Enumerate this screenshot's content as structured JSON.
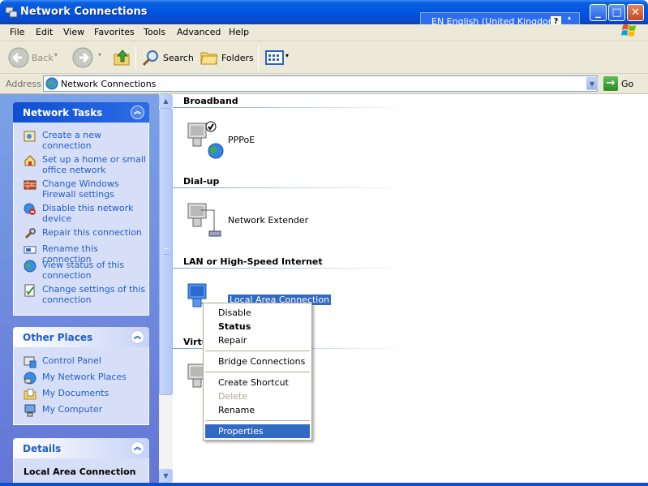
{
  "window": {
    "title": "Network Connections",
    "language": "EN English (United Kingdom)",
    "help_glyph": "?",
    "minimize": "_",
    "maximize": "□",
    "close": "✕"
  },
  "menu": [
    "File",
    "Edit",
    "View",
    "Favorites",
    "Tools",
    "Advanced",
    "Help"
  ],
  "toolbar": {
    "back_label": "Back",
    "search_label": "Search",
    "folders_label": "Folders"
  },
  "address": {
    "label": "Address",
    "value": "Network Connections",
    "go_label": "Go",
    "go_glyph": "→"
  },
  "sidebar": {
    "network_tasks": {
      "title": "Network Tasks",
      "items": [
        {
          "label": "Create a new connection",
          "icon": "new-connection-icon"
        },
        {
          "label": "Set up a home or small office network",
          "icon": "home-network-icon"
        },
        {
          "label": "Change Windows Firewall settings",
          "icon": "firewall-icon"
        },
        {
          "label": "Disable this network device",
          "icon": "disable-device-icon"
        },
        {
          "label": "Repair this connection",
          "icon": "repair-icon"
        },
        {
          "label": "Rename this connection",
          "icon": "rename-icon"
        },
        {
          "label": "View status of this connection",
          "icon": "status-icon"
        },
        {
          "label": "Change settings of this connection",
          "icon": "settings-icon"
        }
      ]
    },
    "other_places": {
      "title": "Other Places",
      "items": [
        {
          "label": "Control Panel",
          "icon": "control-panel-icon"
        },
        {
          "label": "My Network Places",
          "icon": "network-places-icon"
        },
        {
          "label": "My Documents",
          "icon": "documents-icon"
        },
        {
          "label": "My Computer",
          "icon": "computer-icon"
        }
      ]
    },
    "details": {
      "title": "Details",
      "subtitle": "Local Area Connection"
    },
    "collapse_glyph": "︽"
  },
  "groups": [
    {
      "title": "Broadband",
      "items": [
        {
          "label": "PPPoE",
          "icon": "broadband-connection-icon"
        }
      ]
    },
    {
      "title": "Dial-up",
      "items": [
        {
          "label": "Network Extender",
          "icon": "dialup-connection-icon"
        }
      ]
    },
    {
      "title": "LAN or High-Speed Internet",
      "items": [
        {
          "label": "Local Area Connection",
          "icon": "lan-connection-icon",
          "selected": true
        }
      ]
    },
    {
      "title": "Virtu",
      "items": []
    }
  ],
  "context_menu": {
    "items": [
      {
        "label": "Disable"
      },
      {
        "label": "Status",
        "bold": true
      },
      {
        "label": "Repair"
      },
      {
        "label": "Bridge Connections"
      },
      {
        "label": "Create Shortcut"
      },
      {
        "label": "Delete",
        "disabled": true
      },
      {
        "label": "Rename"
      },
      {
        "label": "Properties",
        "highlighted": true
      }
    ]
  },
  "colors": {
    "titlebar": "#0053e1",
    "selection": "#316ac5",
    "task_link": "#215dc6",
    "pane_bg": "#7ba2e7"
  }
}
